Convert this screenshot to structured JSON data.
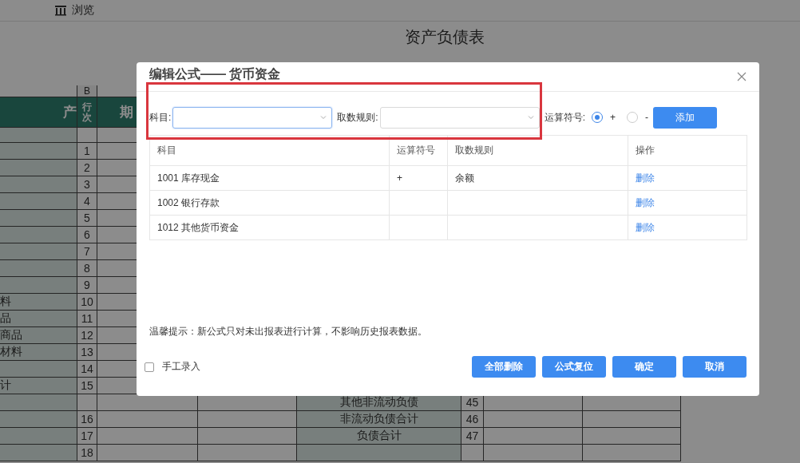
{
  "toolbar": {
    "view_label": "浏览"
  },
  "report_title": "资产负债表",
  "sheet": {
    "column_letter": "B",
    "headers": [
      "产",
      "行次",
      "期"
    ],
    "rows": [
      {},
      {
        "line": "1"
      },
      {
        "line": "2"
      },
      {
        "line": "3"
      },
      {
        "line": "4"
      },
      {
        "line": "5"
      },
      {
        "line": "6"
      },
      {
        "line": "7"
      },
      {
        "line": "8"
      },
      {
        "line": "9"
      },
      {
        "label": "料",
        "line": "10"
      },
      {
        "label": "品",
        "line": "11"
      },
      {
        "label": "商品",
        "line": "12"
      },
      {
        "label": "材料",
        "line": "13"
      },
      {
        "line": "14"
      },
      {
        "label": "计",
        "line": "15"
      },
      {
        "item": "其他非流动负债",
        "item_line": "45"
      },
      {
        "line": "16",
        "item": "非流动负债合计",
        "item_line": "46"
      },
      {
        "line": "17",
        "item": "负债合计",
        "item_line": "47"
      },
      {
        "line": "18"
      }
    ]
  },
  "dialog": {
    "title": "编辑公式—— 货币资金",
    "form": {
      "subject_label": "科目:",
      "rule_label": "取数规则:",
      "operator_label": "运算符号:",
      "operators": [
        {
          "label": "+",
          "selected": true
        },
        {
          "label": "-",
          "selected": false
        }
      ],
      "add_button": "添加"
    },
    "table": {
      "columns": [
        "科目",
        "运算符号",
        "取数规则",
        "操作"
      ],
      "rows": [
        {
          "subject": "1001 库存现金",
          "operator": "+",
          "rule": "余额",
          "action": "删除"
        },
        {
          "subject": "1002 银行存款",
          "action": "删除"
        },
        {
          "subject": "1012 其他货币资金",
          "action": "删除"
        }
      ]
    },
    "hint": "温馨提示：新公式只对未出报表进行计算，不影响历史报表数据。",
    "manual_entry": {
      "label": "手工录入",
      "checked": false
    },
    "buttons": [
      "全部删除",
      "公式复位",
      "确定",
      "取消"
    ]
  }
}
